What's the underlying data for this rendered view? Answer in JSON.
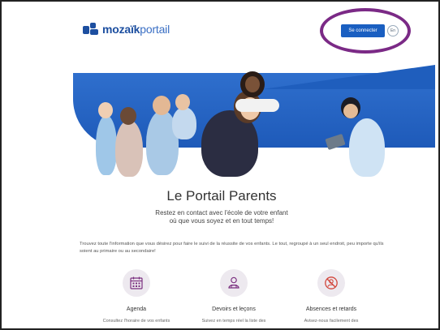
{
  "header": {
    "logo_bold": "mozaïk",
    "logo_light": "portail",
    "connect_label": "Se connecter",
    "lang_label": "En"
  },
  "main": {
    "title": "Le Portail Parents",
    "subtitle_line1": "Restez en contact avec l'école de votre enfant",
    "subtitle_line2": "où que vous soyez et en tout temps!",
    "description": "Trouvez toute l'information que vous désirez pour faire le suivi de la réussite de vos enfants. Le tout, regroupé à un seul endroit, peu importe qu'ils soient au primaire ou au secondaire!"
  },
  "features": [
    {
      "icon": "calendar-icon",
      "title": "Agenda",
      "text": "Consultez l'horaire de vos enfants"
    },
    {
      "icon": "student-icon",
      "title": "Devoirs et leçons",
      "text": "Suivez en temps réel la liste des"
    },
    {
      "icon": "absence-icon",
      "title": "Absences et retards",
      "text": "Avisez-nous facilement des"
    }
  ],
  "colors": {
    "brand_blue": "#1d4fa0",
    "button_blue": "#1a5fc1",
    "highlight_purple": "#7b2a86",
    "icon_accent": "#7a2f7f"
  }
}
